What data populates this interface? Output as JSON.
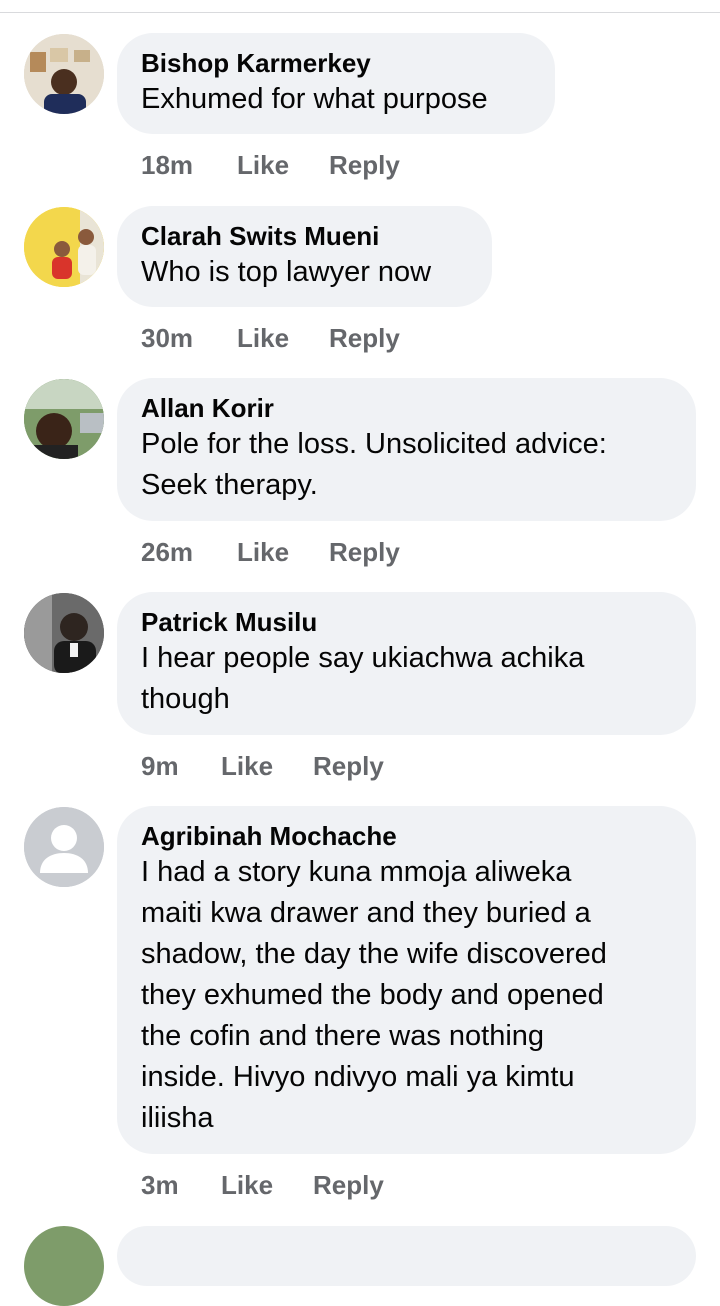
{
  "comments": [
    {
      "name": "Bishop Karmerkey",
      "text": "Exhumed for what purpose",
      "time": "18m",
      "like": "Like",
      "reply": "Reply"
    },
    {
      "name": "Clarah Swits Mueni",
      "text": "Who is top lawyer now",
      "time": "30m",
      "like": "Like",
      "reply": "Reply"
    },
    {
      "name": "Allan Korir",
      "text": "Pole for the loss. Unsolicited advice:\nSeek therapy.",
      "time": "26m",
      "like": "Like",
      "reply": "Reply"
    },
    {
      "name": "Patrick Musilu",
      "text": "I hear people say ukiachwa achika\nthough",
      "time": "9m",
      "like": "Like",
      "reply": "Reply"
    },
    {
      "name": "Agribinah Mochache",
      "text": "I had a story kuna mmoja aliweka\nmaiti kwa drawer and they buried a\nshadow, the day the wife discovered\nthey exhumed the body and opened\nthe cofin and there was nothing\ninside. Hivyo ndivyo mali ya kimtu\niliisha",
      "time": "3m",
      "like": "Like",
      "reply": "Reply"
    }
  ],
  "colors": {
    "bubble": "#f0f2f5",
    "meta": "#65676b",
    "text": "#050505"
  }
}
